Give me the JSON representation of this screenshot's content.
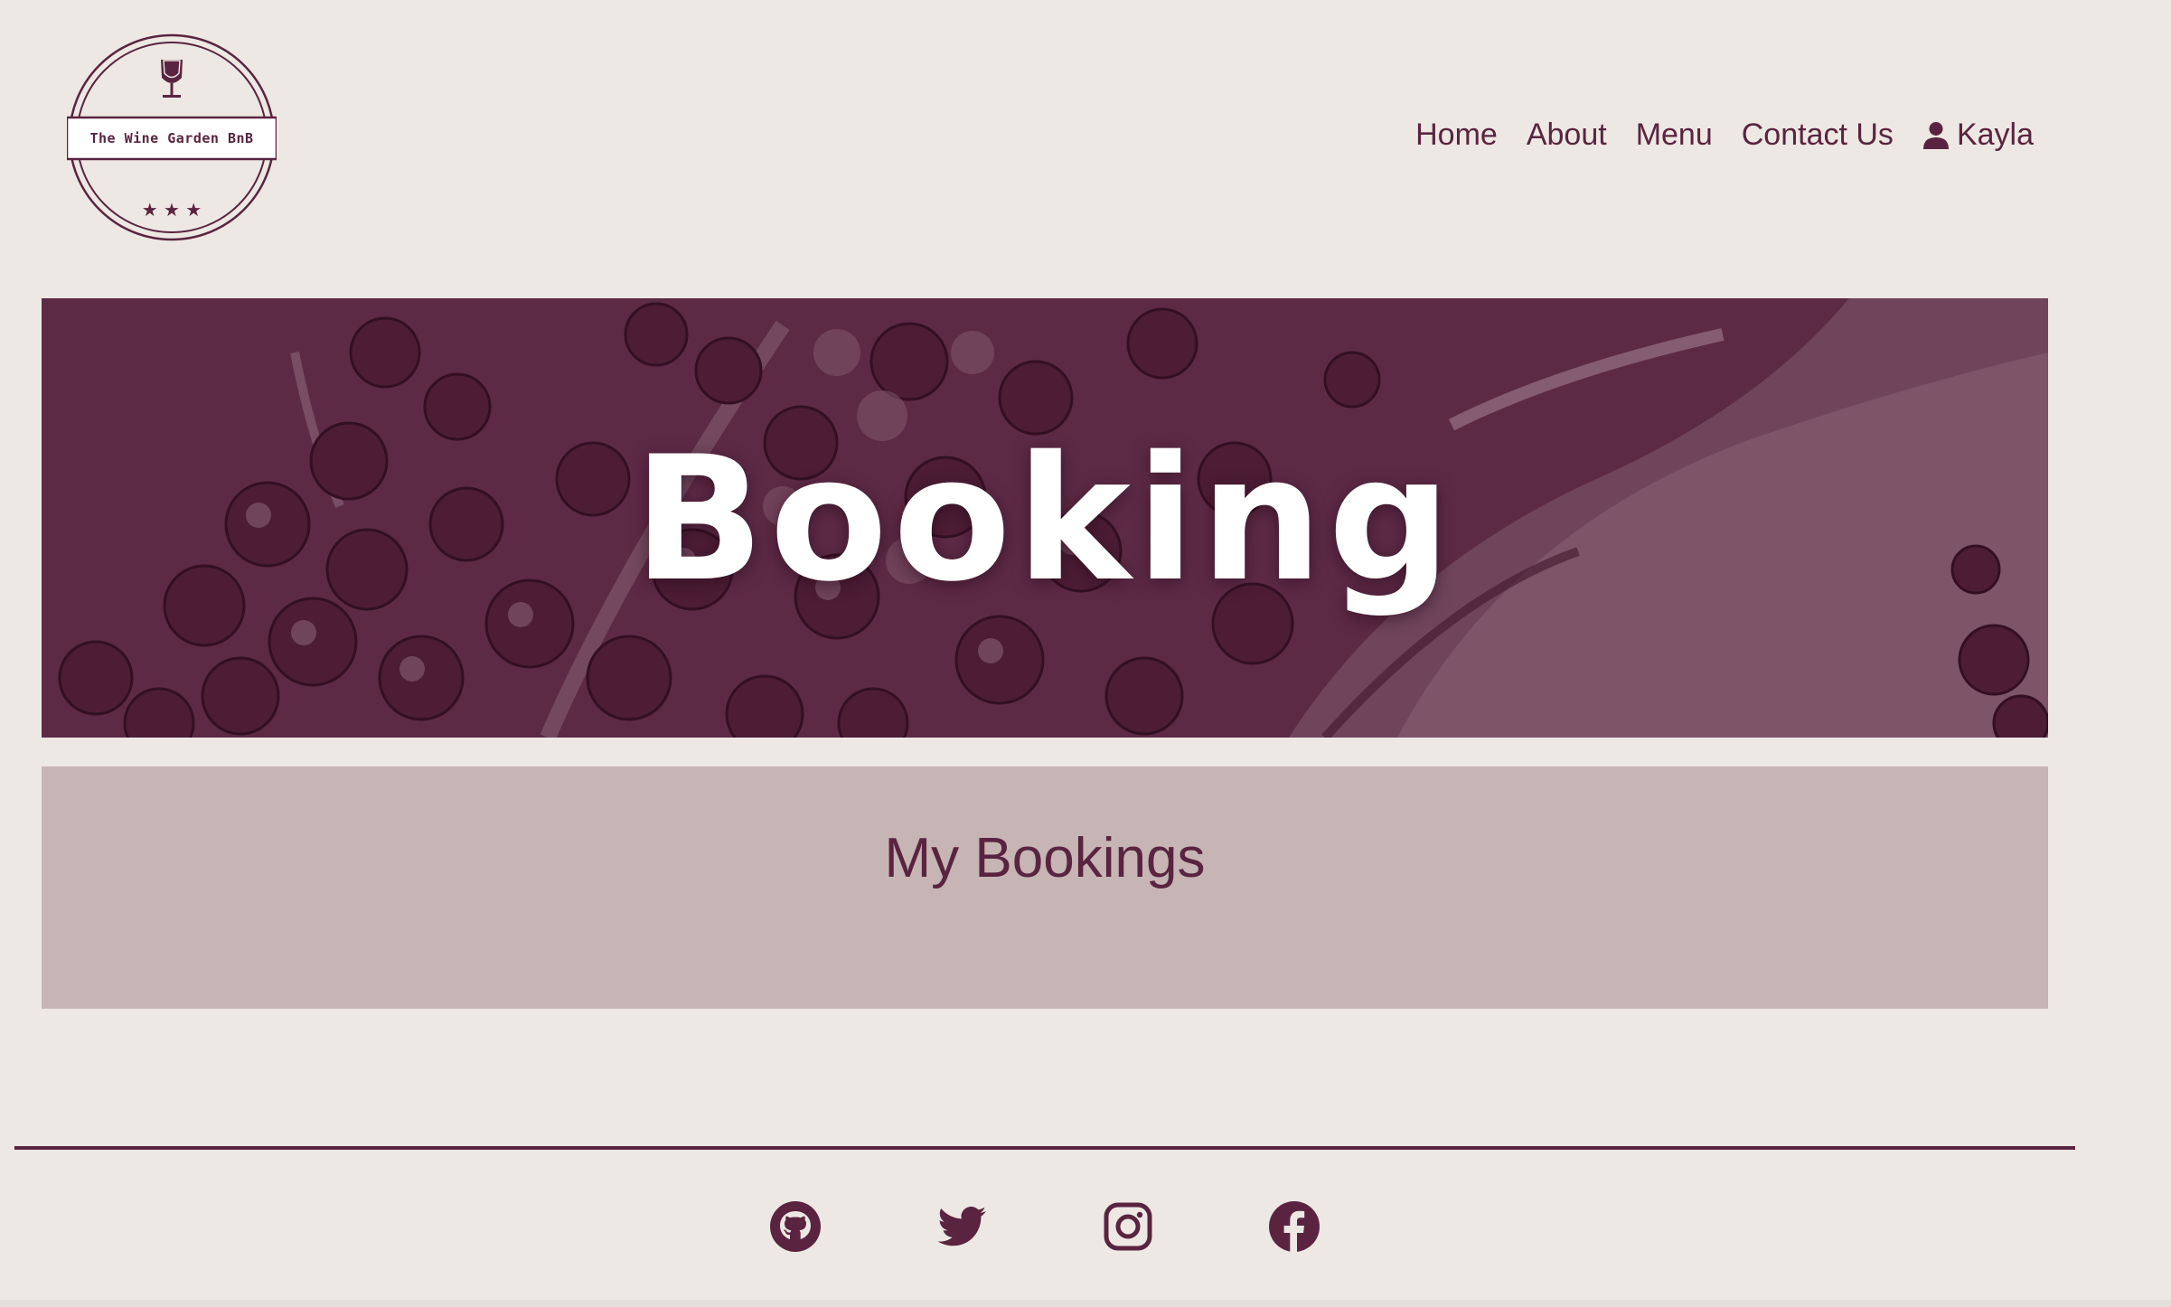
{
  "brand": {
    "name": "The Wine Garden BnB",
    "stars": "★ ★ ★",
    "color": "#5a2440"
  },
  "nav": {
    "items": [
      {
        "label": "Home"
      },
      {
        "label": "About"
      },
      {
        "label": "Menu"
      },
      {
        "label": "Contact Us"
      }
    ],
    "user": {
      "label": "Kayla",
      "icon": "user-icon"
    }
  },
  "hero": {
    "title": "Booking"
  },
  "panel": {
    "title": "My Bookings"
  },
  "footer": {
    "socials": [
      {
        "name": "github-icon"
      },
      {
        "name": "twitter-icon"
      },
      {
        "name": "instagram-icon"
      },
      {
        "name": "facebook-icon"
      }
    ]
  },
  "colors": {
    "background": "#ede8e3",
    "accent": "#5a2440",
    "panel": "#c6b5b4"
  }
}
